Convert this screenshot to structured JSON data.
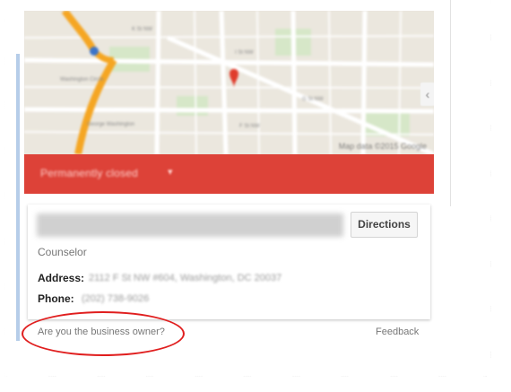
{
  "map": {
    "attribution": "Map data ©2015 Google",
    "pin_color": "#e03c2c"
  },
  "status_bar": {
    "text": "Permanently closed",
    "color": "#dd4238"
  },
  "listing": {
    "name": "",
    "category": "Counselor",
    "directions_label": "Directions",
    "address_label": "Address:",
    "address_value": "2112 F St NW #604, Washington, DC 20037",
    "phone_label": "Phone:",
    "phone_value": "(202) 738-9026"
  },
  "footer": {
    "owner_link": "Are you the business owner?",
    "feedback_link": "Feedback"
  },
  "annotation": {
    "circle_color": "#e01e1e"
  }
}
